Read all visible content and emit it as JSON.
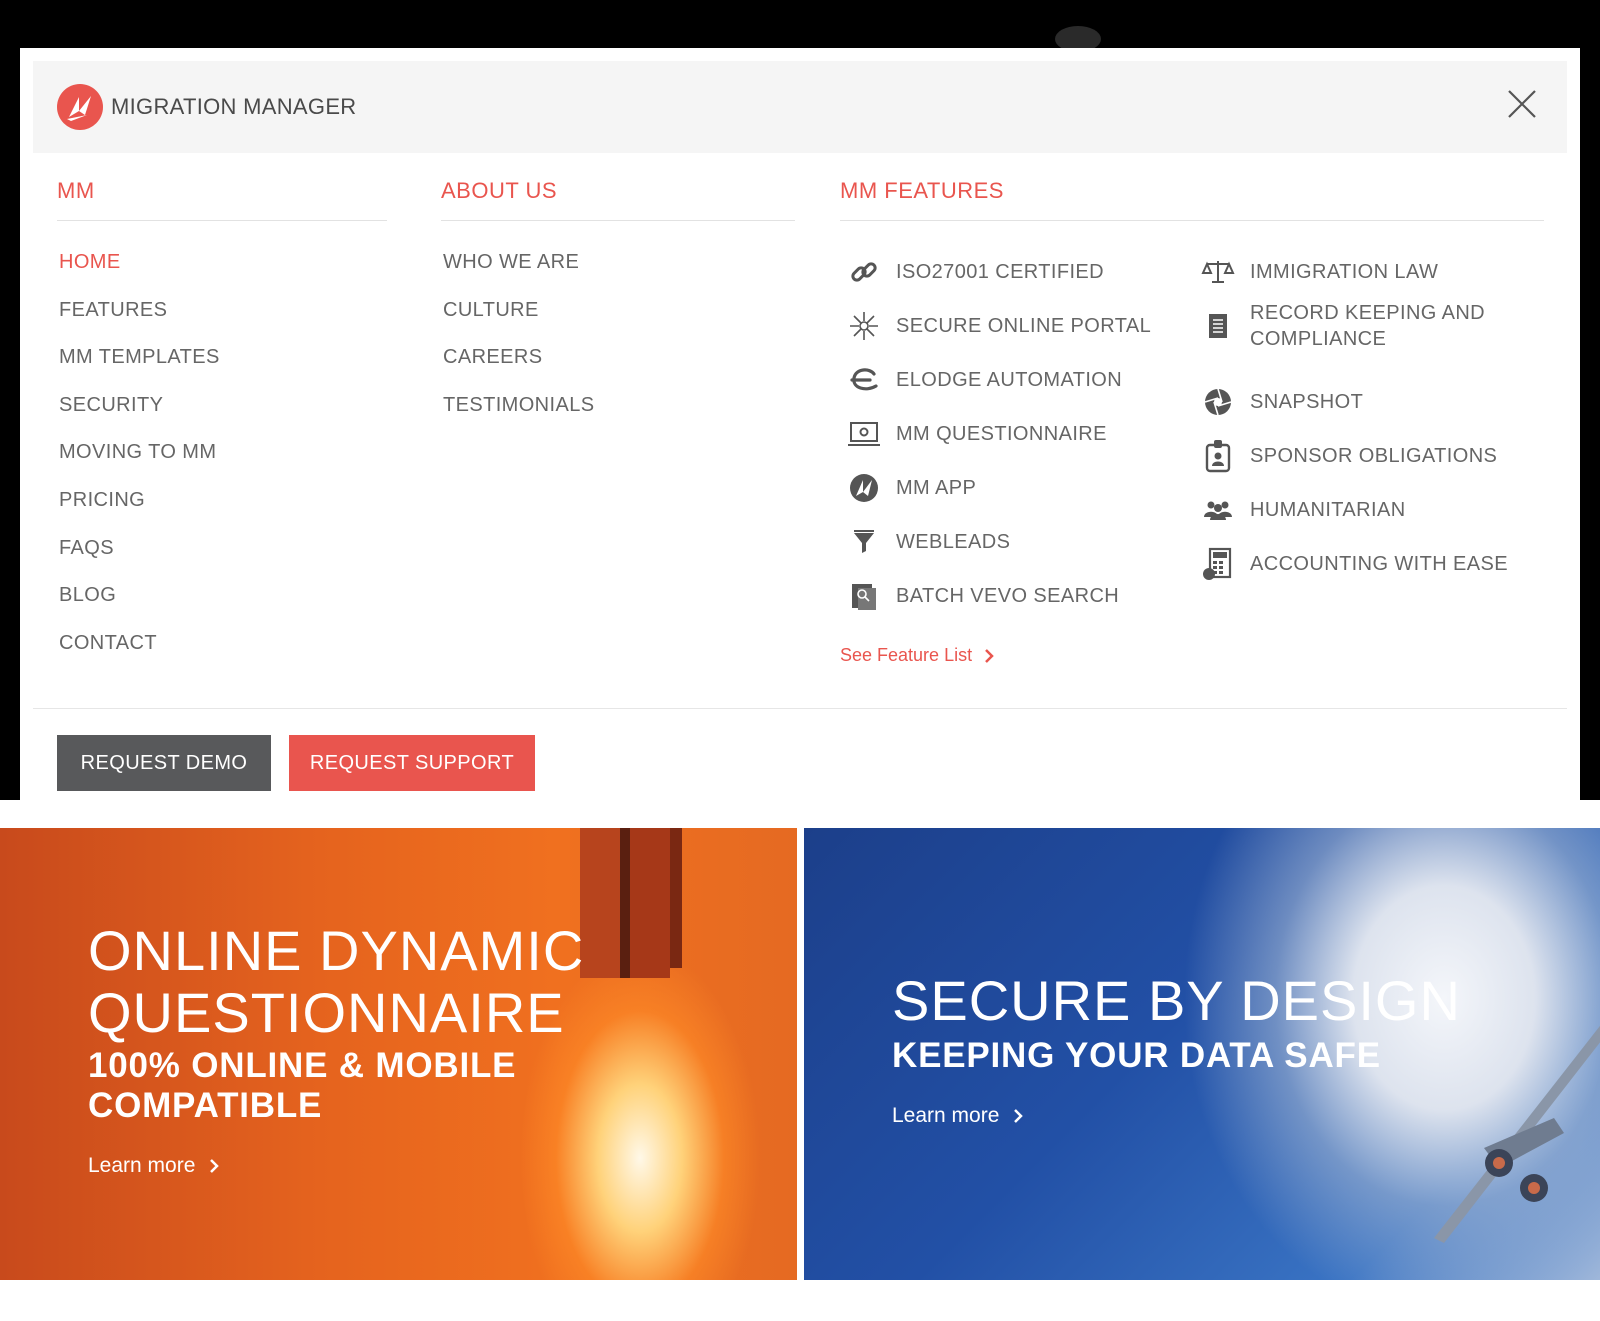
{
  "brand": {
    "name": "MIGRATION MANAGER",
    "accent": "#e9554e",
    "dark_button": "#58595b"
  },
  "columns": {
    "mm": {
      "heading": "MM",
      "items": [
        {
          "label": "HOME",
          "active": true
        },
        {
          "label": "FEATURES"
        },
        {
          "label": "MM TEMPLATES"
        },
        {
          "label": "SECURITY"
        },
        {
          "label": "MOVING TO MM"
        },
        {
          "label": "PRICING"
        },
        {
          "label": "FAQS"
        },
        {
          "label": "BLOG"
        },
        {
          "label": "CONTACT"
        }
      ]
    },
    "about": {
      "heading": "ABOUT US",
      "items": [
        {
          "label": "WHO WE ARE"
        },
        {
          "label": "CULTURE"
        },
        {
          "label": "CAREERS"
        },
        {
          "label": "TESTIMONIALS"
        }
      ]
    },
    "features": {
      "heading": "MM FEATURES",
      "left": [
        {
          "label": "ISO27001 CERTIFIED",
          "icon": "link-icon"
        },
        {
          "label": "SECURE ONLINE PORTAL",
          "icon": "network-icon"
        },
        {
          "label": "ELODGE AUTOMATION",
          "icon": "elodge-icon"
        },
        {
          "label": "MM QUESTIONNAIRE",
          "icon": "laptop-icon"
        },
        {
          "label": "MM APP",
          "icon": "app-logo-icon"
        },
        {
          "label": "WEBLEADS",
          "icon": "funnel-icon"
        },
        {
          "label": "BATCH VEVO SEARCH",
          "icon": "passport-search-icon"
        }
      ],
      "right": [
        {
          "label": "IMMIGRATION LAW",
          "icon": "scales-icon"
        },
        {
          "label": "RECORD KEEPING AND COMPLIANCE",
          "icon": "document-icon"
        },
        {
          "label": "SNAPSHOT",
          "icon": "aperture-icon"
        },
        {
          "label": "SPONSOR OBLIGATIONS",
          "icon": "id-badge-icon"
        },
        {
          "label": "HUMANITARIAN",
          "icon": "people-icon"
        },
        {
          "label": "ACCOUNTING WITH EASE",
          "icon": "calculator-icon"
        }
      ],
      "see_list": "See Feature List"
    }
  },
  "buttons": {
    "demo": "REQUEST DEMO",
    "support": "REQUEST SUPPORT"
  },
  "heroes": {
    "left": {
      "title_line1": "ONLINE DYNAMIC",
      "title_line2": "QUESTIONNAIRE",
      "sub_line1": "100% ONLINE & MOBILE",
      "sub_line2": "COMPATIBLE",
      "link": "Learn more"
    },
    "right": {
      "title": "SECURE BY DESIGN",
      "sub": "KEEPING YOUR DATA SAFE",
      "link": "Learn more"
    }
  }
}
